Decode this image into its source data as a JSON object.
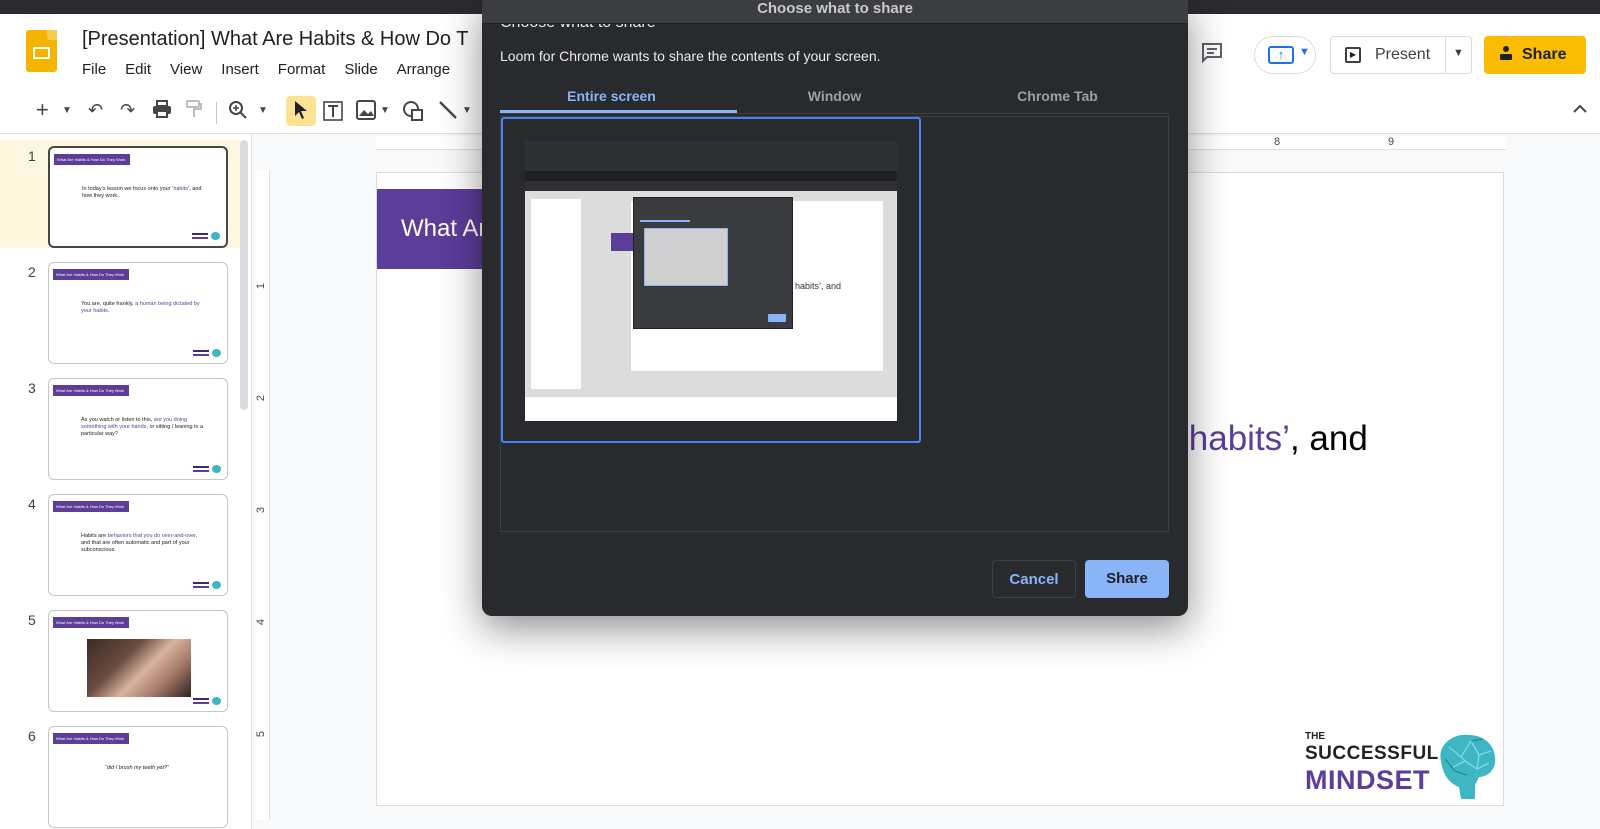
{
  "app": {
    "doc_title": "[Presentation] What Are Habits & How Do T",
    "menu": [
      "File",
      "Edit",
      "View",
      "Insert",
      "Format",
      "Slide",
      "Arrange"
    ],
    "present_label": "Present",
    "share_label": "Share"
  },
  "toolbar": {
    "icons": [
      "add-icon",
      "undo-icon",
      "redo-icon",
      "print-icon",
      "paint-format-icon",
      "zoom-icon",
      "select-icon",
      "text-box-icon",
      "image-icon",
      "shape-icon",
      "line-icon"
    ]
  },
  "rulers": {
    "horizontal": [
      "8",
      "9"
    ],
    "vertical": [
      "1",
      "2",
      "3",
      "4",
      "5"
    ]
  },
  "filmstrip": {
    "slides": [
      {
        "num": "1",
        "band": "What Are Habits & How Do They Work",
        "pre": "In today’s lesson we focus onto your ‘",
        "hl": "habits",
        "post": "’, and how they work..",
        "active": true
      },
      {
        "num": "2",
        "band": "What Are Habits & How Do They Work",
        "pre": "You are, quite frankly, ",
        "hl": "a human being dictated by your habits",
        "post": "."
      },
      {
        "num": "3",
        "band": "What Are Habits & How Do They Work",
        "pre": "As you watch or listen to this, ",
        "hl": "are you doing something with your hands",
        "post": ", or sitting / leaning in a particular way?"
      },
      {
        "num": "4",
        "band": "What Are Habits & How Do They Work",
        "pre": "Habits are ",
        "hl": "behaviors that you do over-and-over",
        "post": ", and that are often automatic and part of your subconscious."
      },
      {
        "num": "5",
        "band": "What Are Habits & How Do They Work",
        "pre": "",
        "hl": "",
        "post": ""
      },
      {
        "num": "6",
        "band": "What Are Habits & How Do They Work",
        "pre": "“did I brush my teeth yet?”",
        "hl": "",
        "post": ""
      }
    ]
  },
  "slide": {
    "band_title": "What Ar",
    "text_highlight": "‘habits’",
    "text_rest": ", and",
    "brand_the": "THE",
    "brand_successful": "SUCCESSFUL",
    "brand_mindset": "MINDSET"
  },
  "dialog": {
    "title": "Choose what to share",
    "heading": "Choose what to share",
    "subtitle": "Loom for Chrome wants to share the contents of your screen.",
    "tabs": [
      "Entire screen",
      "Window",
      "Chrome Tab"
    ],
    "active_tab": "Entire screen",
    "preview_text": "habits’, and",
    "cancel_label": "Cancel",
    "share_label": "Share"
  },
  "colors": {
    "accent_purple": "#5c3d99",
    "dialog_bg": "#292a2d",
    "dialog_accent": "#8ab4f8",
    "share_yellow": "#fbbc04"
  }
}
